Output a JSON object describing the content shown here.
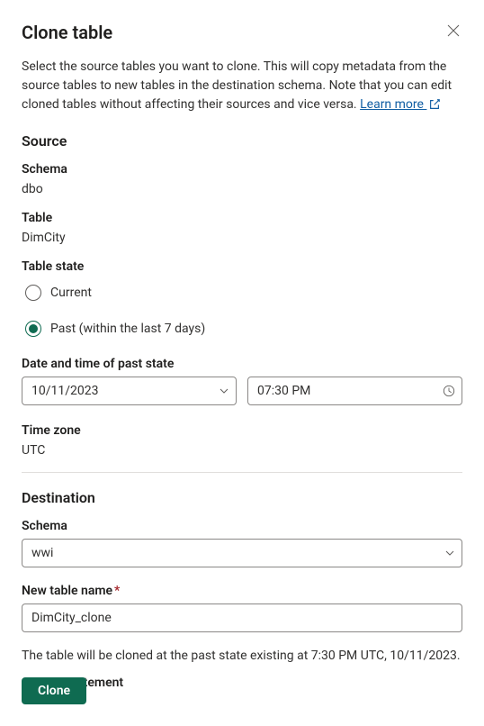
{
  "dialog": {
    "title": "Clone table",
    "description_prefix": "Select the source tables you want to clone. This will copy metadata from the source tables to new tables in the destination schema. Note that you can edit cloned tables without affecting their sources and vice versa. ",
    "learn_more": "Learn more "
  },
  "source": {
    "heading": "Source",
    "schema_label": "Schema",
    "schema_value": "dbo",
    "table_label": "Table",
    "table_value": "DimCity",
    "table_state_label": "Table state",
    "radio_current": "Current",
    "radio_past": "Past (within the last 7 days)",
    "datetime_label": "Date and time of past state",
    "date_value": "10/11/2023",
    "time_value": "07:30 PM",
    "timezone_label": "Time zone",
    "timezone_value": "UTC"
  },
  "destination": {
    "heading": "Destination",
    "schema_label": "Schema",
    "schema_value": "wwi",
    "new_table_label": "New table name",
    "new_table_value": "DimCity_clone"
  },
  "note": "The table will be cloned at the past state existing at 7:30 PM UTC, 10/11/2023.",
  "sql_expander": "SQL statement",
  "footer": {
    "clone": "Clone"
  }
}
